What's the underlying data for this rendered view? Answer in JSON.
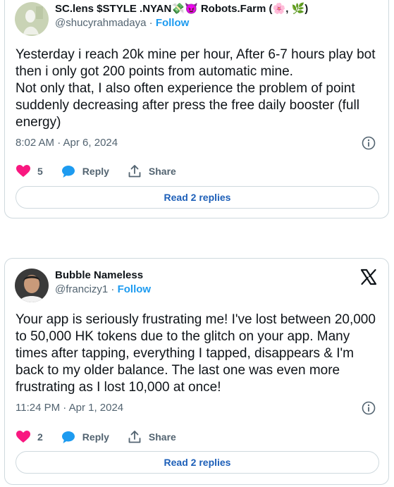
{
  "posts": [
    {
      "display_name": "SC.lens $STYLE .NYAN💸😈 Robots.Farm (🌸, 🌿)",
      "handle": "@shucyrahmadaya",
      "separator": "·",
      "follow_label": "Follow",
      "text": "Yesterday i reach 20k mine per hour, After 6-7 hours play bot then i only got 200 points from automatic mine.\nNot only that, I also often experience the problem of point suddenly decreasing after press the free daily booster (full energy)",
      "timestamp": "8:02 AM · Apr 6, 2024",
      "like_count": "5",
      "reply_label": "Reply",
      "share_label": "Share",
      "read_replies_label": "Read 2 replies"
    },
    {
      "display_name": "Bubble Nameless",
      "handle": "@francizy1",
      "separator": "·",
      "follow_label": "Follow",
      "text": "Your app is seriously frustrating me! I've lost between 20,000 to 50,000 HK tokens due to the glitch on your app. Many times after tapping, everything I tapped, disappears & I'm back to my older balance. The last one was even more frustrating as I lost 10,000 at once!",
      "timestamp": "11:24 PM · Apr 1, 2024",
      "like_count": "2",
      "reply_label": "Reply",
      "share_label": "Share",
      "read_replies_label": "Read 2 replies"
    }
  ],
  "icons": {
    "like": "heart-icon",
    "reply": "speech-bubble-icon",
    "share": "share-arrow-icon",
    "info": "info-icon",
    "brand": "x-logo-icon"
  },
  "colors": {
    "like": "#f91880",
    "reply": "#1d9bf0",
    "link": "#1d9bf0",
    "muted": "#536471",
    "border": "#cfd9de"
  }
}
